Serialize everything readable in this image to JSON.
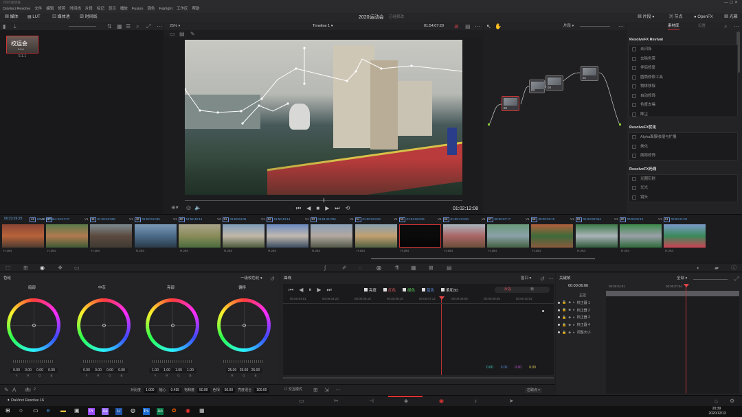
{
  "window": {
    "title": "2020运动会",
    "app": "DaVinci Resolve"
  },
  "menu": [
    "DaVinci Resolve",
    "文件",
    "编辑",
    "修剪",
    "时间线",
    "片段",
    "标记",
    "显示",
    "播放",
    "Fusion",
    "调色",
    "Fairlight",
    "工作区",
    "帮助"
  ],
  "toolbar": {
    "media": "媒体",
    "lut": "LUT",
    "library": "媒体池",
    "timeline_btn": "时间线",
    "project_title": "2020运动会",
    "project_state": "已经修改",
    "clips_btn": "片段",
    "nodes_btn": "节点",
    "openfx_btn": "OpenFX",
    "lightbox_btn": "光箱"
  },
  "viewer": {
    "zoom": "25%",
    "timeline_name": "Timeline 1",
    "timecode_top": "01:54:07:20",
    "timecode": "01:02:12:08"
  },
  "node_editor": {
    "mode": "片段",
    "nodes": [
      {
        "label": "01"
      },
      {
        "label": "02"
      },
      {
        "label": "03"
      },
      {
        "label": "04"
      }
    ]
  },
  "library": {
    "tab_active": "素材库",
    "tab_other": "设置",
    "sections": [
      {
        "title": "ResolveFX Revival",
        "items": [
          "去闪烁",
          "去除色带",
          "伴侣修复",
          "圆筒修修工具",
          "物体移除",
          "自动修饰",
          "色度去噪",
          "降尘"
        ]
      },
      {
        "title": "ResolveFX优化",
        "items": [
          "Alpha面膜收缩与扩展",
          "美化",
          "面部修饰"
        ]
      },
      {
        "title": "ResolveFX光线",
        "items": [
          "光圈衍射",
          "光光",
          "镜头"
        ]
      }
    ]
  },
  "media_pool": {
    "clip_label": "校运会",
    "clip_sub": "1.1.1",
    "clip_code": "5.1.1"
  },
  "clips": [
    {
      "num": "46",
      "tc": "00:10:29:09",
      "track": "V1",
      "codec": "H.264"
    },
    {
      "num": "47",
      "tc": "14:43:47:27",
      "track": "V1",
      "codec": "H.264"
    },
    {
      "num": "48",
      "tc": "01:48:40:006",
      "track": "V1",
      "codec": "H.264"
    },
    {
      "num": "49",
      "tc": "01:52:04:045",
      "track": "V1",
      "codec": "H.264"
    },
    {
      "num": "50",
      "tc": "01:52:40:14",
      "track": "V1",
      "codec": "H.264"
    },
    {
      "num": "51",
      "tc": "01:53:04:09",
      "track": "V2",
      "codec": "H.264"
    },
    {
      "num": "52",
      "tc": "01:50:43:14",
      "track": "V1",
      "codec": "H.264"
    },
    {
      "num": "53",
      "tc": "01:51:21:006",
      "track": "V1",
      "codec": "H.264"
    },
    {
      "num": "54",
      "tc": "01:50:03:018",
      "track": "V1",
      "codec": "H.264"
    },
    {
      "num": "55",
      "tc": "01:54:06:015",
      "track": "V1",
      "codec": "H.264"
    },
    {
      "num": "56",
      "tc": "01:55:42:040",
      "track": "V1",
      "codec": "H.264"
    },
    {
      "num": "57",
      "tc": "00:00:07:17",
      "track": "V1",
      "codec": "H.264"
    },
    {
      "num": "58",
      "tc": "00:00:02:15",
      "track": "V1",
      "codec": "H.264"
    },
    {
      "num": "59",
      "tc": "01:00:00:064",
      "track": "V1",
      "codec": "H.264"
    },
    {
      "num": "60",
      "tc": "00:00:06:10",
      "track": "V1",
      "codec": "H.264"
    },
    {
      "num": "61",
      "tc": "00:00:21:02",
      "track": "V1",
      "codec": "H.264"
    }
  ],
  "clips_first_tc": "00:23:26:25",
  "wheels": {
    "mode": "一级校色轮",
    "items": [
      {
        "name": "暗部",
        "vals": [
          "0.00",
          "0.00",
          "0.00",
          "0.00"
        ],
        "labs": [
          "Y",
          "R",
          "G",
          "B"
        ]
      },
      {
        "name": "中灰",
        "vals": [
          "0.00",
          "0.00",
          "0.00",
          "0.00"
        ],
        "labs": [
          "Y",
          "R",
          "G",
          "B"
        ]
      },
      {
        "name": "亮部",
        "vals": [
          "1.00",
          "1.00",
          "1.00",
          "1.00"
        ],
        "labs": [
          "Y",
          "R",
          "G",
          "B"
        ]
      },
      {
        "name": "偏移",
        "vals": [
          "25.00",
          "25.00",
          "25.00"
        ],
        "labs": [
          "R",
          "G",
          "B"
        ]
      }
    ],
    "bottom": {
      "contrast_l": "对比度",
      "contrast": "1.000",
      "pivot_l": "轴心",
      "pivot": "0.435",
      "sat_l": "饱和度",
      "sat": "50.00",
      "hue_l": "色相",
      "hue": "50.00",
      "lum_l": "亮度混合",
      "lum": "100.00"
    }
  },
  "curves": {
    "title": "曲线",
    "checks": [
      "亮度",
      "红色",
      "绿色",
      "蓝色",
      "柔和3D"
    ],
    "btn_a": "片段",
    "btn_b": "帧",
    "values": [
      "0.00",
      "0.00",
      "0.00",
      "0.00"
    ],
    "times": [
      "00:00:04:01",
      "00:00:04:23",
      "00:00:05:19",
      "00:00:06:15",
      "00:00:07:12",
      "00:00:08:08",
      "00:00:09:05",
      "00:00:10:02"
    ],
    "lock": "交互模式",
    "zoom_mode": "左取点"
  },
  "keyframes": {
    "title": "关键帧",
    "mode": "全部",
    "tc": "00:00:06:06",
    "tc2": "00:00:04:01",
    "tc3": "00:00:07:04",
    "rows": [
      "主控",
      "校正器 1",
      "校正器 2",
      "校正器 3",
      "校正器 4",
      "调整大小"
    ]
  },
  "pages": {
    "app_name": "DaVinci Resolve 16"
  },
  "taskbar": {
    "time": "20:39",
    "date": "2020/12/13"
  }
}
